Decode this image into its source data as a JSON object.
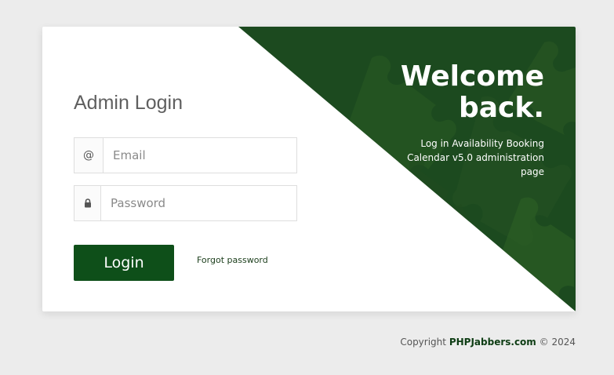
{
  "login": {
    "title": "Admin Login",
    "email_icon": "at-icon",
    "email_placeholder": "Email",
    "password_icon": "lock-icon",
    "password_placeholder": "Password",
    "login_label": "Login",
    "forgot_label": "Forgot password"
  },
  "banner": {
    "heading_line1": "Welcome",
    "heading_line2": "back.",
    "subtitle": "Log in Availability Booking Calendar v5.0 administration page",
    "background_motif": "puzzle-pattern"
  },
  "footer": {
    "prefix": "Copyright",
    "brand": "PHPJabbers.com",
    "suffix": "© 2024"
  },
  "colors": {
    "accent": "#0e4f19",
    "banner": "#1c4a1f",
    "page_bg": "#ececec"
  }
}
